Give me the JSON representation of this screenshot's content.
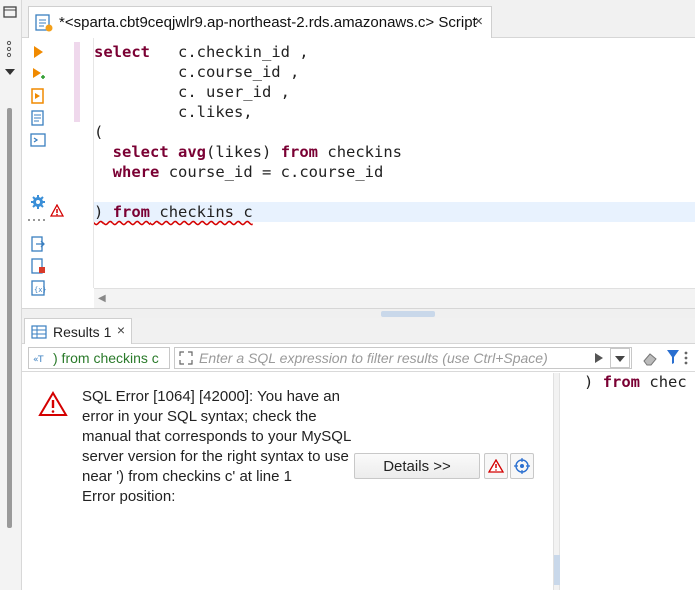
{
  "editor": {
    "tab_title": "*<sparta.cbt9ceqjwlr9.ap-northeast-2.rds.amazonaws.c> Script",
    "close_glyph": "×",
    "code_lines": [
      {
        "kw": "select",
        "rest": "   c.checkin_id ,"
      },
      {
        "kw": "",
        "rest": "         c.course_id ,"
      },
      {
        "kw": "",
        "rest": "         c. user_id ,"
      },
      {
        "kw": "",
        "rest": "         c.likes,"
      },
      {
        "kw": "",
        "rest": "("
      },
      {
        "kw": "",
        "rest": ""
      },
      {
        "kw": "",
        "rest": ""
      },
      {
        "kw": "",
        "rest": ""
      },
      {
        "kw": "",
        "rest": ""
      }
    ],
    "line5": {
      "select": "select",
      "avg": "avg",
      "args": "(likes)",
      "from": "from",
      "table": "checkins"
    },
    "line6": {
      "where": "where",
      "cond": "course_id = c.course_id"
    },
    "line8": {
      "paren": ")",
      "from": "from",
      "rest": "checkins c"
    }
  },
  "results": {
    "tab_label": "Results 1",
    "close_glyph": "×",
    "query_chip": ") from checkins c",
    "filter_placeholder": "Enter a SQL expression to filter results (use Ctrl+Space)",
    "error_message": "SQL Error [1064] [42000]: You have an error in your SQL syntax; check the manual that corresponds to your MySQL server version for the right syntax to use near ') from checkins c' at line 1",
    "error_position": "Error position:",
    "details_button": "Details >>",
    "right_code_paren": ")",
    "right_code_from": "from",
    "right_code_rest": "chec"
  },
  "colors": {
    "keyword": "#7a0033",
    "error_red": "#d40000",
    "current_line": "#e8f2fe"
  }
}
